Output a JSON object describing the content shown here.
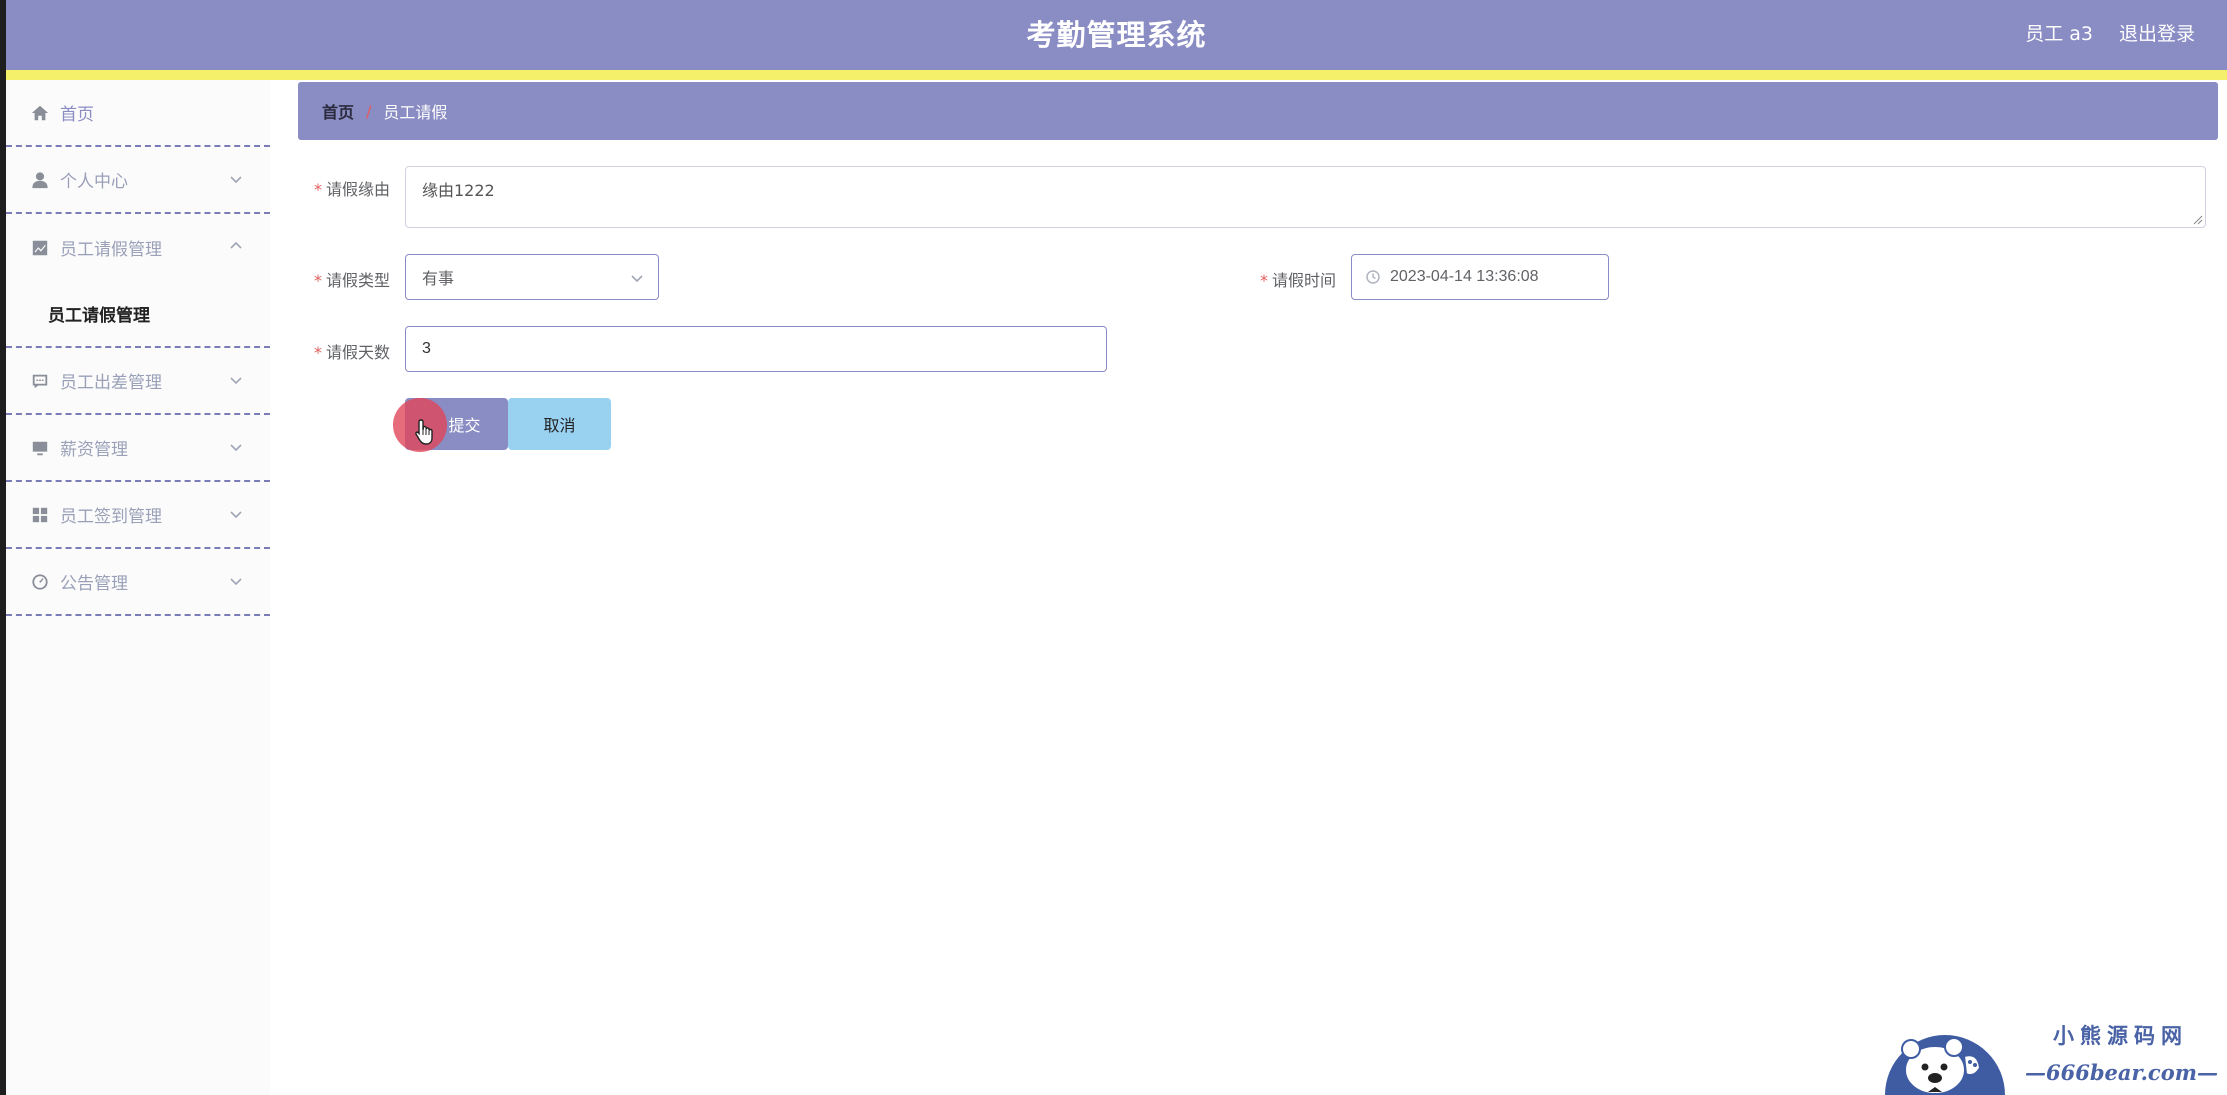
{
  "header": {
    "title": "考勤管理系统",
    "user": "员工 a3",
    "logout": "退出登录"
  },
  "sidebar": {
    "items": [
      {
        "label": "首页",
        "icon": "home-icon"
      },
      {
        "label": "个人中心",
        "icon": "user-icon"
      },
      {
        "label": "员工请假管理",
        "icon": "chart-icon",
        "expanded": true,
        "children": [
          "员工请假管理"
        ]
      },
      {
        "label": "员工出差管理",
        "icon": "chat-icon"
      },
      {
        "label": "薪资管理",
        "icon": "monitor-icon"
      },
      {
        "label": "员工签到管理",
        "icon": "grid-icon"
      },
      {
        "label": "公告管理",
        "icon": "gauge-icon"
      }
    ]
  },
  "breadcrumb": {
    "home": "首页",
    "separator": "/",
    "current": "员工请假"
  },
  "form": {
    "required_mark": "*",
    "reason": {
      "label": "请假缘由",
      "value": "缘由1222"
    },
    "type": {
      "label": "请假类型",
      "value": "有事"
    },
    "time": {
      "label": "请假时间",
      "value": "2023-04-14 13:36:08"
    },
    "days": {
      "label": "请假天数",
      "value": "3"
    },
    "submit_label": "提交",
    "cancel_label": "取消"
  },
  "watermark": {
    "name": "小熊源码网",
    "url": "—666bear.com—"
  },
  "colors": {
    "primary": "#8a8cc4",
    "accent_bar": "#f5f06a",
    "cancel": "#99d1f0",
    "required": "#e25d5d"
  }
}
